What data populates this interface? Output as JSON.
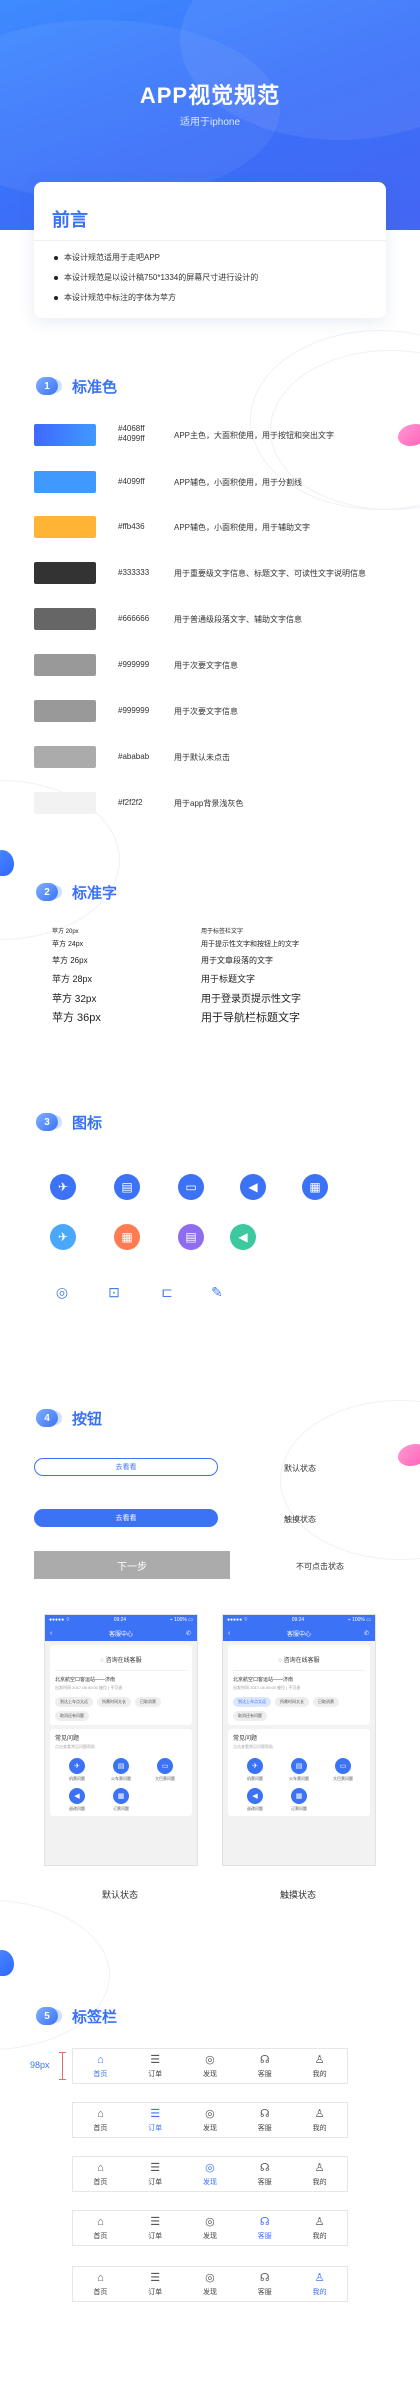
{
  "header": {
    "title": "APP视觉规范",
    "subtitle": "适用于iphone"
  },
  "intro": {
    "title": "前言",
    "items": [
      "本设计规范适用于走吧APP",
      "本设计规范是以设计稿750*1334的屏幕尺寸进行设计的",
      "本设计规范中标注的字体为苹方"
    ]
  },
  "sections": {
    "colors": {
      "num": "1",
      "title": "标准色"
    },
    "fonts": {
      "num": "2",
      "title": "标准字"
    },
    "icons": {
      "num": "3",
      "title": "图标"
    },
    "buttons": {
      "num": "4",
      "title": "按钮"
    },
    "tabbar": {
      "num": "5",
      "title": "标签栏"
    }
  },
  "colors": [
    {
      "code_line1": "#4068ff",
      "code_line2": "#4099ff",
      "desc": "APP主色，大面积使用，用于按钮和突出文字",
      "gradient_from": "#4068ff",
      "gradient_to": "#4099ff"
    },
    {
      "code_line1": "#4099ff",
      "code_line2": "",
      "desc": "APP辅色，小面积使用，用于分割线",
      "swatch": "#4099ff"
    },
    {
      "code_line1": "#ffb436",
      "code_line2": "",
      "desc": "APP辅色，小面积使用，用于辅助文字",
      "swatch": "#ffb436"
    },
    {
      "code_line1": "#333333",
      "code_line2": "",
      "desc": "用于重要级文字信息、标题文字、可读性文字说明信息",
      "swatch": "#333333"
    },
    {
      "code_line1": "#666666",
      "code_line2": "",
      "desc": "用于普通级段落文字、辅助文字信息",
      "swatch": "#666666"
    },
    {
      "code_line1": "#999999",
      "code_line2": "",
      "desc": "用于次要文字信息",
      "swatch": "#999999"
    },
    {
      "code_line1": "#999999",
      "code_line2": "",
      "desc": "用于次要文字信息",
      "swatch": "#999999"
    },
    {
      "code_line1": "#ababab",
      "code_line2": "",
      "desc": "用于默认未点击",
      "swatch": "#ababab"
    },
    {
      "code_line1": "#f2f2f2",
      "code_line2": "",
      "desc": "用于app背景浅灰色",
      "swatch": "#f2f2f2"
    }
  ],
  "fonts": {
    "sizes": [
      "苹方 20px",
      "苹方 24px",
      "苹方 26px",
      "苹方 28px",
      "苹方 32px",
      "苹方 36px"
    ],
    "usages": [
      "用于标签栏文字",
      "用于提示性文字和按钮上的文字",
      "用于文章段落的文字",
      "用于标题文字",
      "用于登录页提示性文字",
      "用于导航栏标题文字"
    ]
  },
  "icons": {
    "row1": [
      "plane-icon",
      "bus-icon",
      "wallet-icon",
      "send-icon",
      "receipt-icon"
    ],
    "row2": [
      "plane-icon",
      "receipt-icon",
      "bus-icon",
      "send-icon"
    ],
    "row3": [
      "coupon-icon",
      "bag-icon",
      "ticket-icon",
      "edit-icon"
    ],
    "row1_colors": [
      "#3c72f6",
      "#3c72f6",
      "#3c72f6",
      "#3c72f6",
      "#3c72f6"
    ],
    "row2_colors": [
      "#4aa8f8",
      "#ff7b52",
      "#8f6cf0",
      "#3dc9a0"
    ]
  },
  "buttons": {
    "outline_label": "去看看",
    "outline_state": "默认状态",
    "filled_label": "去看看",
    "filled_state": "触摸状态",
    "disabled_label": "下一步",
    "disabled_state": "不可点击状态"
  },
  "phones": [
    {
      "label": "默认状态",
      "status_left": "●●●●● ⌔",
      "status_time": "09:24",
      "status_right": "⌁ 100% ▭",
      "nav_title": "客服中心",
      "online": "咨询在线客服",
      "question": "北京航空口客运站——济南",
      "question_sub": "出发时间 2017-06 00:00 座位 | 不可退",
      "chips": [
        "到达上车点太远",
        "所需时间太长",
        "已取消票",
        "取消还有问题"
      ],
      "common_title": "常见问题",
      "common_sub": "点击查看常见问题帮助",
      "grid": [
        "机票问题",
        "火车票问题",
        "大巴票问题",
        "退改问题",
        "订票问题"
      ],
      "active_chip": -1
    },
    {
      "label": "触摸状态",
      "status_left": "●●●●● ⌔",
      "status_time": "09:24",
      "status_right": "⌁ 100% ▭",
      "nav_title": "客服中心",
      "online": "咨询在线客服",
      "question": "北京航空口客运站——济南",
      "question_sub": "出发时间 2017-06 00:00 座位 | 不可退",
      "chips": [
        "到达上车点太远",
        "所需时间太长",
        "已取消票",
        "取消还有问题"
      ],
      "common_title": "常见问题",
      "common_sub": "点击查看常见问题帮助",
      "grid": [
        "机票问题",
        "火车票问题",
        "大巴票问题",
        "退改问题",
        "订票问题"
      ],
      "active_chip": 0
    }
  ],
  "tabbar": {
    "height_label": "98px",
    "items": [
      {
        "label": "首页",
        "icon": "home-icon",
        "glyph": "⌂"
      },
      {
        "label": "订单",
        "icon": "order-icon",
        "glyph": "☰"
      },
      {
        "label": "发现",
        "icon": "discover-icon",
        "glyph": "◎"
      },
      {
        "label": "客服",
        "icon": "service-icon",
        "glyph": "☊"
      },
      {
        "label": "我的",
        "icon": "profile-icon",
        "glyph": "♙"
      }
    ],
    "active_index_per_bar": [
      0,
      1,
      2,
      3,
      4
    ]
  }
}
